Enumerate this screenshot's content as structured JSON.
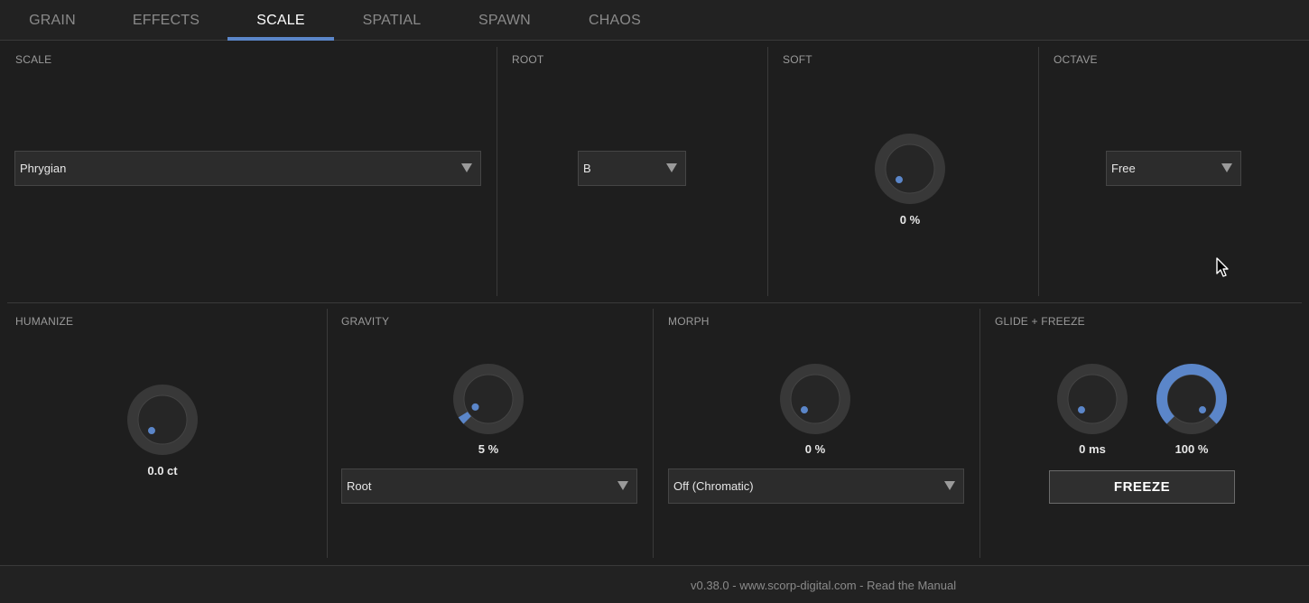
{
  "tabs": [
    {
      "label": "GRAIN",
      "active": false
    },
    {
      "label": "EFFECTS",
      "active": false
    },
    {
      "label": "SCALE",
      "active": true
    },
    {
      "label": "SPATIAL",
      "active": false
    },
    {
      "label": "SPAWN",
      "active": false
    },
    {
      "label": "CHAOS",
      "active": false
    }
  ],
  "scale": {
    "title": "SCALE",
    "selected": "Phrygian"
  },
  "root": {
    "title": "ROOT",
    "selected": "B"
  },
  "soft": {
    "title": "SOFT",
    "value_label": "0 %",
    "value": 0
  },
  "octave": {
    "title": "OCTAVE",
    "selected": "Free"
  },
  "humanize": {
    "title": "HUMANIZE",
    "value_label": "0.0 ct",
    "value": 0
  },
  "gravity": {
    "title": "GRAVITY",
    "value_label": "5 %",
    "value": 0.05,
    "mode": "Root"
  },
  "morph": {
    "title": "MORPH",
    "value_label": "0 %",
    "value": 0,
    "mode": "Off (Chromatic)"
  },
  "glide_freeze": {
    "title": "GLIDE + FREEZE",
    "glide_label": "0 ms",
    "glide_value": 0,
    "freeze_amount_label": "100 %",
    "freeze_amount_value": 1.0,
    "freeze_button": "FREEZE"
  },
  "footer": {
    "version": "v0.38.0",
    "sep1": " - ",
    "website": "www.scorp-digital.com",
    "sep2": " - ",
    "manual": "Read the Manual"
  },
  "colors": {
    "accent": "#5b86c9",
    "background": "#1e1e1e",
    "knob": "#3a3a3a"
  },
  "icons": {
    "dropdown": "triangle-down-icon",
    "pointer": "mouse-pointer-icon"
  }
}
